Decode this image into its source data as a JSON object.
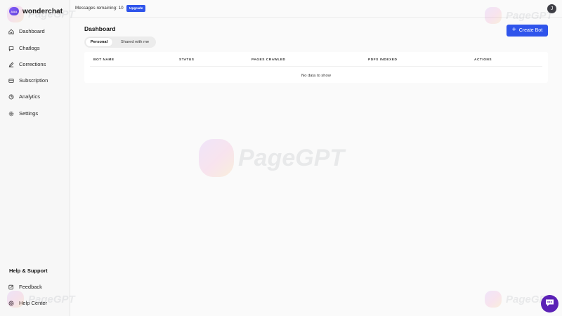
{
  "sidebar": {
    "brand": {
      "logo_text": "AAA",
      "name": "wonderchat"
    },
    "nav": [
      {
        "label": "Dashboard",
        "icon": "home-icon"
      },
      {
        "label": "Chatlogs",
        "icon": "chat-bubble-icon"
      },
      {
        "label": "Corrections",
        "icon": "pencil-icon"
      },
      {
        "label": "Subscription",
        "icon": "credit-card-icon"
      },
      {
        "label": "Analytics",
        "icon": "pie-chart-icon"
      },
      {
        "label": "Settings",
        "icon": "gear-icon"
      }
    ],
    "help": {
      "title": "Help & Support",
      "items": [
        {
          "label": "Feedback",
          "icon": "edit-square-icon"
        },
        {
          "label": "Help Center",
          "icon": "lifebuoy-icon"
        }
      ]
    }
  },
  "topbar": {
    "messages_remaining": "Messages remaining: 10",
    "upgrade_label": "Upgrade",
    "avatar_initial": "J"
  },
  "main": {
    "title": "Dashboard",
    "create_button": "Create Bot",
    "tabs": [
      {
        "label": "Personal",
        "active": true
      },
      {
        "label": "Shared with me",
        "active": false
      }
    ],
    "table": {
      "columns": [
        "BOT NAME",
        "STATUS",
        "PAGES CRAWLED",
        "PDFS INDEXED",
        "ACTIONS"
      ],
      "rows": [],
      "empty_text": "No data to show"
    }
  },
  "watermark": {
    "text": "PageGPT"
  },
  "colors": {
    "accent": "#2f54eb",
    "chat_fab": "#5b21b6",
    "sidebar_bg": "#f7f7f7"
  }
}
